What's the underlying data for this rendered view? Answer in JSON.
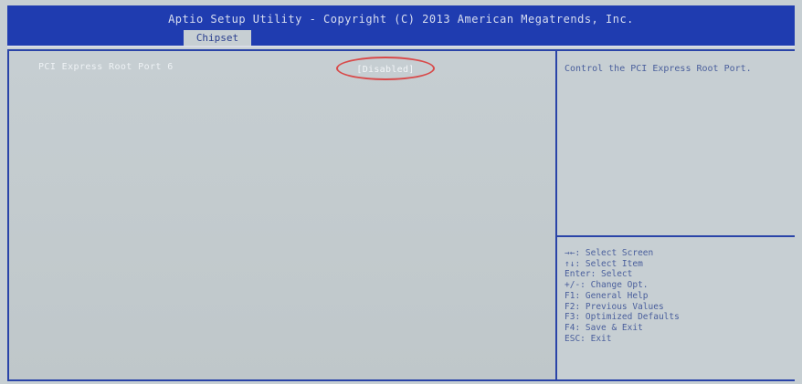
{
  "header": {
    "title": "Aptio Setup Utility - Copyright (C) 2013 American Megatrends, Inc.",
    "active_tab": "Chipset"
  },
  "setting": {
    "label": "PCI Express Root Port 6",
    "value": "[Disabled]"
  },
  "help": {
    "text": "Control the PCI Express Root Port."
  },
  "keys": [
    "→←: Select Screen",
    "↑↓: Select Item",
    "Enter: Select",
    "+/-: Change Opt.",
    "F1: General Help",
    "F2: Previous Values",
    "F3: Optimized Defaults",
    "F4: Save & Exit",
    "ESC: Exit"
  ],
  "colors": {
    "header_blue": "#1f3cb0",
    "highlight_circle": "#d84a4a",
    "panel_grey": "#c7cfd3"
  }
}
